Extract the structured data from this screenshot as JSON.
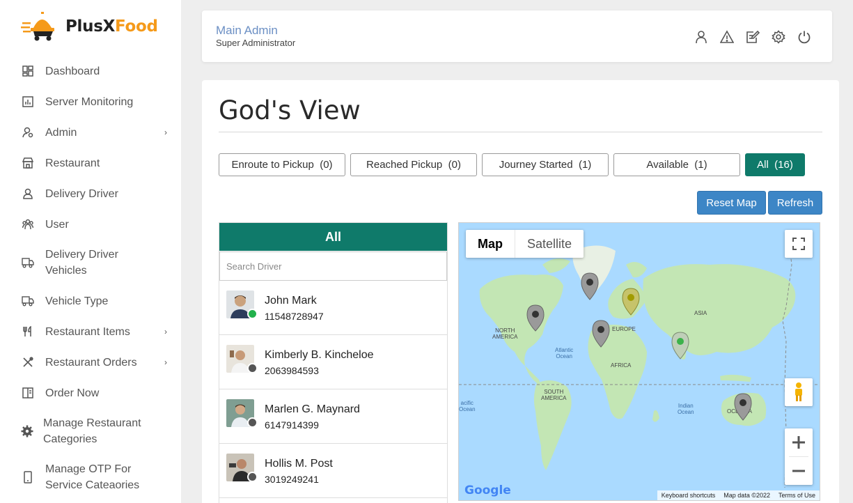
{
  "brand": {
    "name_part1": "PlusX",
    "name_part2": "Food",
    "accent": "#f59a1a"
  },
  "sidebar": {
    "items": [
      {
        "label": "Dashboard",
        "icon": "dashboard-icon",
        "has_submenu": false
      },
      {
        "label": "Server Monitoring",
        "icon": "monitor-chart-icon",
        "has_submenu": false
      },
      {
        "label": "Admin",
        "icon": "user-gear-icon",
        "has_submenu": true
      },
      {
        "label": "Restaurant",
        "icon": "store-icon",
        "has_submenu": false
      },
      {
        "label": "Delivery Driver",
        "icon": "driver-icon",
        "has_submenu": false
      },
      {
        "label": "User",
        "icon": "users-icon",
        "has_submenu": false
      },
      {
        "label": "Delivery Driver Vehicles",
        "icon": "truck-icon",
        "has_submenu": false
      },
      {
        "label": "Vehicle Type",
        "icon": "truck-icon",
        "has_submenu": false
      },
      {
        "label": "Restaurant Items",
        "icon": "fork-knife-icon",
        "has_submenu": true
      },
      {
        "label": "Restaurant Orders",
        "icon": "utensils-cross-icon",
        "has_submenu": true
      },
      {
        "label": "Order Now",
        "icon": "menu-book-icon",
        "has_submenu": false
      },
      {
        "label": "Manage Restaurant Categories",
        "icon": "gear-icon",
        "has_submenu": false
      },
      {
        "label": "Manage OTP For Service Cateaories",
        "icon": "phone-icon",
        "has_submenu": false
      }
    ]
  },
  "header": {
    "user_name": "Main Admin",
    "user_role": "Super Administrator",
    "icons": [
      "profile-icon",
      "alert-icon",
      "edit-icon",
      "settings-icon",
      "power-icon"
    ]
  },
  "main": {
    "title": "God's View",
    "filters": [
      {
        "label": "Enroute to Pickup",
        "count": "(0)"
      },
      {
        "label": "Reached Pickup",
        "count": "(0)"
      },
      {
        "label": "Journey Started",
        "count": "(1)"
      },
      {
        "label": "Available",
        "count": "(1)"
      },
      {
        "label": "All",
        "count": "(16)",
        "active": true
      }
    ],
    "reset_map_label": "Reset Map",
    "refresh_label": "Refresh"
  },
  "driver_list": {
    "title": "All",
    "search_placeholder": "Search Driver",
    "drivers": [
      {
        "name": "John Mark",
        "phone": "11548728947",
        "status": "online",
        "status_color": "#22b14c"
      },
      {
        "name": "Kimberly B. Kincheloe",
        "phone": "2063984593",
        "status": "offline",
        "status_color": "#555555"
      },
      {
        "name": "Marlen G. Maynard",
        "phone": "6147914399",
        "status": "offline",
        "status_color": "#555555"
      },
      {
        "name": "Hollis M. Post",
        "phone": "3019249241",
        "status": "offline",
        "status_color": "#555555"
      }
    ]
  },
  "map": {
    "type_map": "Map",
    "type_satellite": "Satellite",
    "labels": {
      "north_america": "NORTH\nAMERICA",
      "south_america": "SOUTH\nAMERICA",
      "europe": "EUROPE",
      "africa": "AFRICA",
      "asia": "ASIA",
      "oceania": "OCEANIA"
    },
    "oceans": {
      "atlantic": "Atlantic\nOcean",
      "indian": "Indian\nOcean",
      "pacific": "acific\nOcean"
    },
    "footer": {
      "shortcuts": "Keyboard shortcuts",
      "data": "Map data ©2022",
      "terms": "Terms of Use"
    },
    "logo": "Google"
  }
}
